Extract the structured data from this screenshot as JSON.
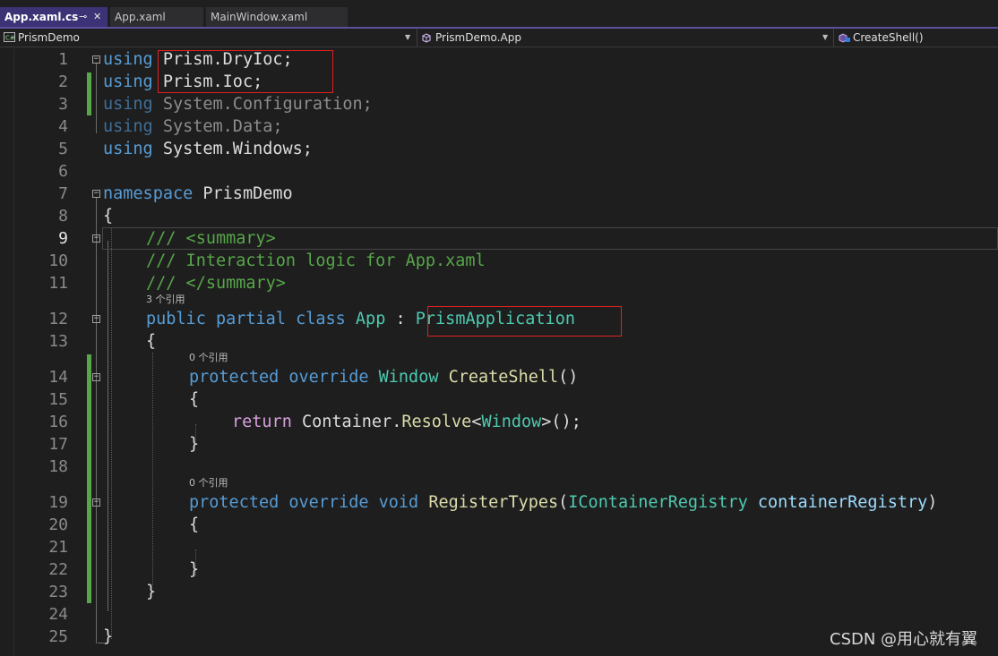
{
  "tabs": [
    {
      "label": "App.xaml.cs",
      "active": true,
      "pin_icon": "pin-icon",
      "close_icon": "close-icon"
    },
    {
      "label": "App.xaml",
      "active": false
    },
    {
      "label": "MainWindow.xaml",
      "active": false
    }
  ],
  "navbar": {
    "project": "PrismDemo",
    "type": "PrismDemo.App",
    "member": "CreateShell()",
    "project_icon": "csharp-project-icon",
    "type_icon": "class-icon",
    "member_icon": "method-icon"
  },
  "lines": [
    {
      "n": "1"
    },
    {
      "n": "2"
    },
    {
      "n": "3"
    },
    {
      "n": "4"
    },
    {
      "n": "5"
    },
    {
      "n": "6"
    },
    {
      "n": "7"
    },
    {
      "n": "8"
    },
    {
      "n": "9"
    },
    {
      "n": "10"
    },
    {
      "n": "11"
    },
    {
      "n": "12"
    },
    {
      "n": "13"
    },
    {
      "n": "14"
    },
    {
      "n": "15"
    },
    {
      "n": "16"
    },
    {
      "n": "17"
    },
    {
      "n": "18"
    },
    {
      "n": "19"
    },
    {
      "n": "20"
    },
    {
      "n": "21"
    },
    {
      "n": "22"
    },
    {
      "n": "23"
    },
    {
      "n": "24"
    },
    {
      "n": "25"
    }
  ],
  "code": {
    "kw_using": "using",
    "l1_ns": " Prism.DryIoc;",
    "l2_ns": " Prism.Ioc;",
    "l3_ns": " System.Configuration;",
    "l4_ns": " System.Data;",
    "l5_ns": " System.Windows;",
    "kw_namespace": "namespace",
    "l7_name": " PrismDemo",
    "brace_open": "{",
    "brace_close": "}",
    "l9": "/// <summary>",
    "l10": "/// Interaction logic for App.xaml",
    "l11": "/// </summary>",
    "kw_public": "public",
    "kw_partial": "partial",
    "kw_class": "class",
    "type_app": "App",
    "colon": " : ",
    "type_base": "PrismApplication",
    "kw_protected": "protected",
    "kw_override": "override",
    "type_window": "Window",
    "m_createshell": "CreateShell",
    "parens": "()",
    "kw_return": "return",
    "l16_container": "Container",
    "dot": ".",
    "m_resolve": "Resolve",
    "lt": "<",
    "gt_tail": ">();",
    "kw_void": "void",
    "m_registertypes": "RegisterTypes",
    "paren_open": "(",
    "type_registry": "IContainerRegistry",
    "param_registry": "containerRegistry",
    "paren_close": ")"
  },
  "codelens": {
    "class_refs": "3 个引用",
    "method1_refs": "0 个引用",
    "method2_refs": "0 个引用"
  },
  "watermark": "CSDN @用心就有翼",
  "colors": {
    "keyword": "#569cd6",
    "control_keyword": "#d8a0df",
    "type": "#4ec9b0",
    "method": "#dcdcaa",
    "comment": "#57a64a",
    "parameter": "#9cdcfe",
    "highlight_box": "#e02020",
    "tab_active": "#3b3375"
  }
}
